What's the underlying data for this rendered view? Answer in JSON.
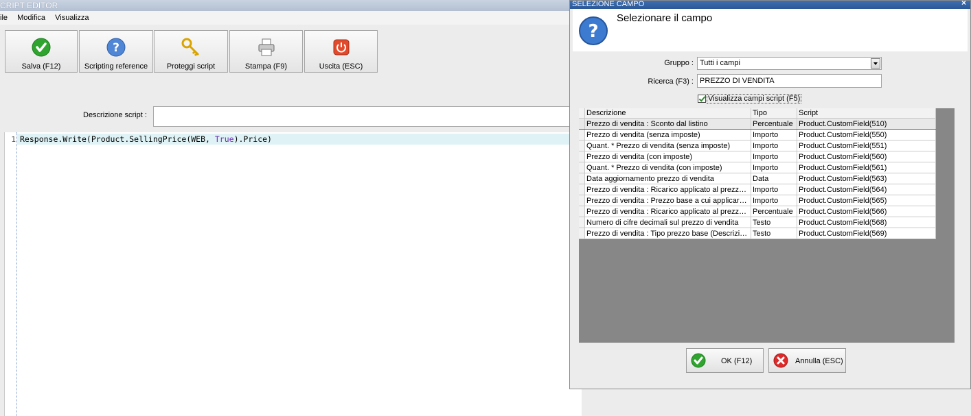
{
  "window": {
    "title": "CRIPT EDITOR"
  },
  "menu": [
    "ile",
    "Modifica",
    "Visualizza"
  ],
  "toolbar": {
    "buttons": [
      {
        "label": "Salva (F12)",
        "icon": "check-icon"
      },
      {
        "label": "Scripting reference",
        "icon": "help-icon"
      },
      {
        "label": "Proteggi script",
        "icon": "key-icon"
      },
      {
        "label": "Stampa (F9)",
        "icon": "printer-icon"
      },
      {
        "label": "Uscita (ESC)",
        "icon": "power-icon"
      }
    ]
  },
  "description": {
    "label": "Descrizione script :",
    "value": ""
  },
  "editor": {
    "line_number": "1",
    "code_before": "Response.Write(Product.SellingPrice(WEB, ",
    "code_keyword": "True",
    "code_after": ").Price)"
  },
  "dialog": {
    "title": "SELEZIONE CAMPO",
    "close": "×",
    "header": "Selezionare il campo",
    "group_label": "Gruppo :",
    "group_value": "Tutti i campi",
    "search_label": "Ricerca (F3) :",
    "search_value": "PREZZO DI VENDITA",
    "checkbox_label": "Visualizza campi script (F5)",
    "checkbox_checked": true,
    "columns": [
      "Descrizione",
      "Tipo",
      "Script"
    ],
    "rows": [
      [
        "Prezzo di vendita : Sconto dal listino",
        "Percentuale",
        "Product.CustomField(510)"
      ],
      [
        "Prezzo di vendita (senza imposte)",
        "Importo",
        "Product.CustomField(550)"
      ],
      [
        "Quant. * Prezzo di vendita (senza imposte)",
        "Importo",
        "Product.CustomField(551)"
      ],
      [
        "Prezzo di vendita (con imposte)",
        "Importo",
        "Product.CustomField(560)"
      ],
      [
        "Quant. * Prezzo di vendita (con imposte)",
        "Importo",
        "Product.CustomField(561)"
      ],
      [
        "Data aggiornamento prezzo di vendita",
        "Data",
        "Product.CustomField(563)"
      ],
      [
        "Prezzo di vendita : Ricarico applicato al prezzo...",
        "Importo",
        "Product.CustomField(564)"
      ],
      [
        "Prezzo di vendita : Prezzo base a cui applicare...",
        "Importo",
        "Product.CustomField(565)"
      ],
      [
        "Prezzo di vendita : Ricarico applicato al prezzo...",
        "Percentuale",
        "Product.CustomField(566)"
      ],
      [
        "Numero di cifre decimali sul prezzo di vendita",
        "Testo",
        "Product.CustomField(568)"
      ],
      [
        "Prezzo di vendita : Tipo prezzo base (Descrizio...",
        "Testo",
        "Product.CustomField(569)"
      ]
    ],
    "ok_label": "OK (F12)",
    "cancel_label": "Annulla (ESC)"
  },
  "colors": {
    "accent": "#2b5797",
    "code_highlight": "#dff3f6",
    "keyword": "#6f2bb1",
    "grid_bg": "#878787"
  }
}
